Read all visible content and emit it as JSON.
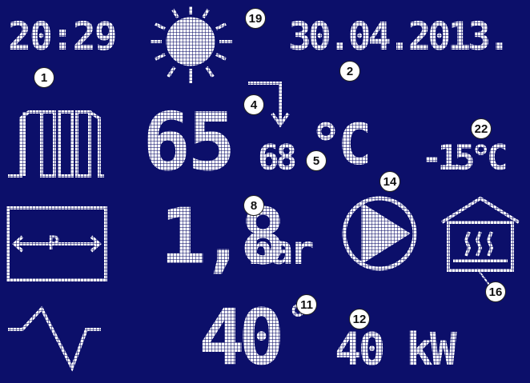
{
  "display": {
    "background_color": "#0c0f6a",
    "foreground_color": "#ffffff"
  },
  "header": {
    "time": "20:29",
    "date": "30.04.2013.",
    "weather_icon": "sun-icon"
  },
  "boiler": {
    "icon": "radiator-icon",
    "current_temp": "65",
    "target_temp": "68",
    "temp_unit": "°C"
  },
  "outdoor": {
    "temperature": "-15°C"
  },
  "pressure": {
    "icon": "pressure-gauge-icon",
    "value": "1,8",
    "unit": "bar"
  },
  "pump": {
    "icon": "pump-icon"
  },
  "room": {
    "icon": "house-heating-icon"
  },
  "burner": {
    "icon": "flow-wave-icon",
    "modulation": "40",
    "modulation_unit": "°",
    "power": "40 kW"
  },
  "markers": [
    "1",
    "2",
    "19",
    "4",
    "5",
    "22",
    "14",
    "8",
    "16",
    "11",
    "12"
  ]
}
